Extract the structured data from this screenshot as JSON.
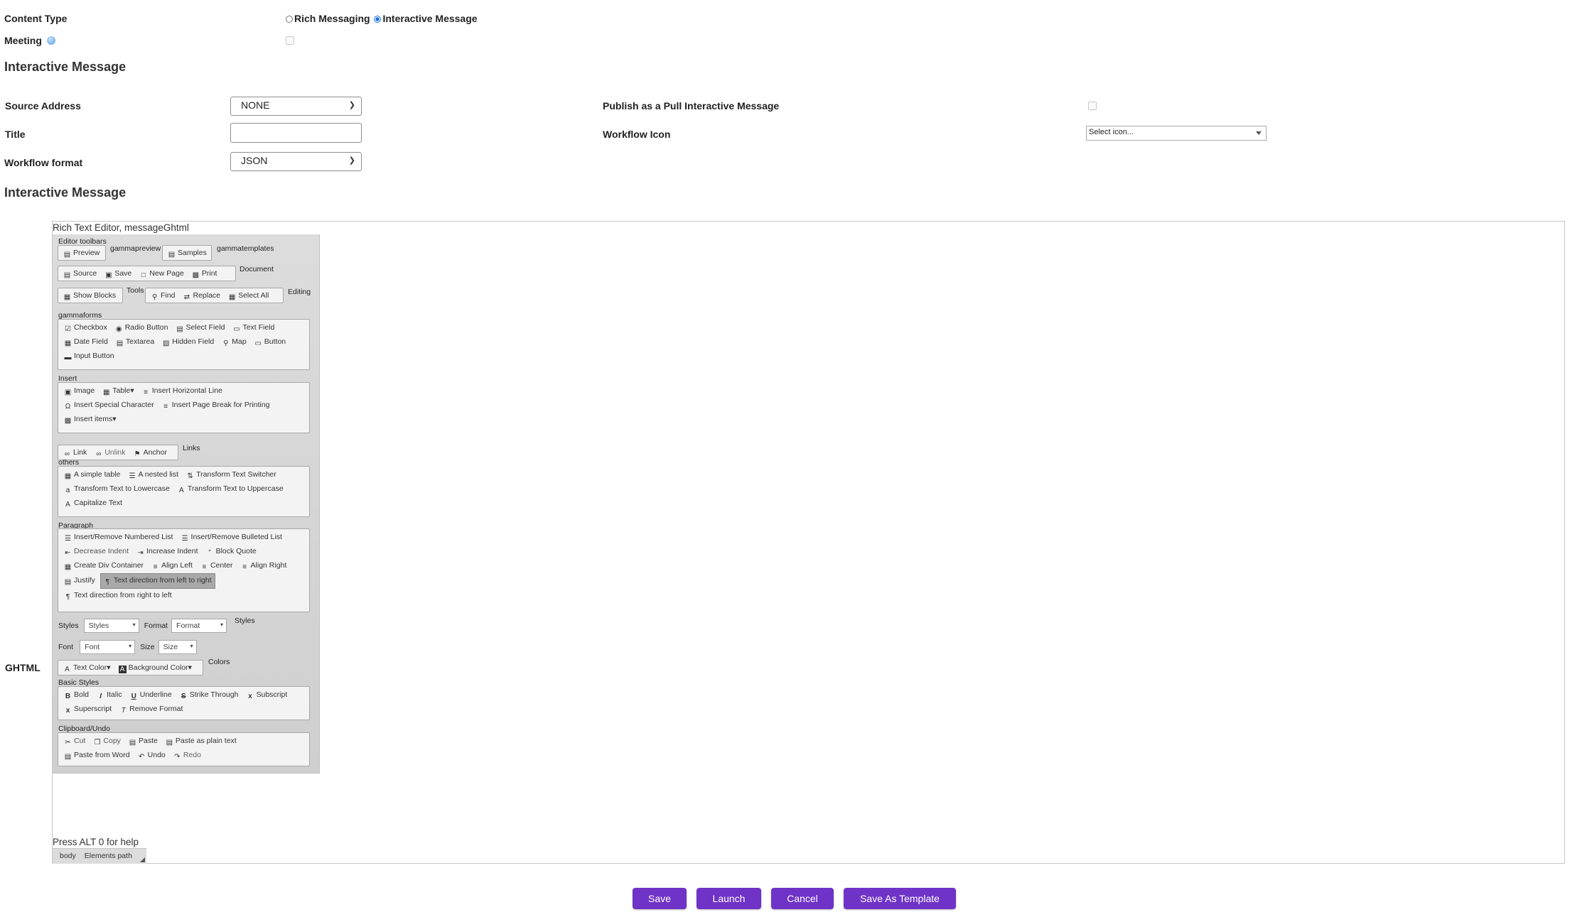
{
  "form": {
    "content_type_label": "Content Type",
    "content_type_options": [
      "Rich Messaging",
      "Interactive Message"
    ],
    "meeting_label": "Meeting",
    "section_title": "Interactive Message",
    "source_address_label": "Source Address",
    "source_address_value": "NONE",
    "title_label": "Title",
    "title_value": "",
    "workflow_format_label": "Workflow format",
    "workflow_format_value": "JSON",
    "publish_label": "Publish as a Pull Interactive Message",
    "workflow_icon_label": "Workflow Icon",
    "workflow_icon_value": "Select icon...",
    "section_title_2": "Interactive Message",
    "ghtml_label": "GHTML"
  },
  "editor": {
    "aria_label": "Rich Text Editor, messageGhtml",
    "toolbars_label": "Editor toolbars",
    "preview_group": {
      "title": "gammapreview",
      "buttons": [
        "Preview"
      ]
    },
    "templates_group": {
      "title": "gammatemplates",
      "buttons": [
        "Samples"
      ]
    },
    "document_group": {
      "title": "Document",
      "buttons": [
        "Source",
        "Save",
        "New Page",
        "Print"
      ]
    },
    "tools_group": {
      "title": "Tools",
      "buttons": [
        "Show Blocks"
      ]
    },
    "editing_group": {
      "title": "Editing",
      "buttons": [
        "Find",
        "Replace",
        "Select All"
      ]
    },
    "forms_group": {
      "title": "gammaforms",
      "rows": [
        [
          "Checkbox",
          "Radio Button",
          "Select Field",
          "Text Field"
        ],
        [
          "Date Field",
          "Textarea",
          "Hidden Field",
          "Map",
          "Button"
        ],
        [
          "Input Button"
        ]
      ]
    },
    "insert_group": {
      "title": "Insert",
      "rows": [
        [
          "Image",
          "Table",
          "Insert Horizontal Line"
        ],
        [
          "Insert Special Character",
          "Insert Page Break for Printing"
        ],
        [
          "Insert items"
        ]
      ]
    },
    "links_group": {
      "title": "Links",
      "buttons": [
        "Link",
        "Unlink",
        "Anchor"
      ]
    },
    "others_group": {
      "title": "others",
      "rows": [
        [
          "A simple table",
          "A nested list",
          "Transform Text Switcher"
        ],
        [
          "Transform Text to Lowercase",
          "Transform Text to Uppercase"
        ],
        [
          "Capitalize Text"
        ]
      ]
    },
    "paragraph_group": {
      "title": "Paragraph",
      "rows": [
        [
          "Insert/Remove Numbered List",
          "Insert/Remove Bulleted List"
        ],
        [
          "Decrease Indent",
          "Increase Indent",
          "Block Quote"
        ],
        [
          "Create Div Container",
          "Align Left",
          "Center",
          "Align Right"
        ],
        [
          "Justify",
          "Text direction from left to right"
        ],
        [
          "Text direction from right to left"
        ]
      ]
    },
    "styles_group": {
      "title": "Styles",
      "styles_label": "Styles",
      "styles_value": "Styles",
      "format_label": "Format",
      "format_value": "Format",
      "font_label": "Font",
      "font_value": "Font",
      "size_label": "Size",
      "size_value": "Size"
    },
    "colors_group": {
      "title": "Colors",
      "buttons": [
        "Text Color",
        "Background Color"
      ]
    },
    "basic_group": {
      "title": "Basic Styles",
      "rows": [
        [
          "Bold",
          "Italic",
          "Underline",
          "Strike Through",
          "Subscript"
        ],
        [
          "Superscript",
          "Remove Format"
        ]
      ]
    },
    "clipboard_group": {
      "title": "Clipboard/Undo",
      "rows": [
        [
          "Cut",
          "Copy",
          "Paste",
          "Paste as plain text"
        ],
        [
          "Paste from Word",
          "Undo",
          "Redo"
        ]
      ]
    },
    "help_text": "Press ALT 0 for help",
    "path_body": "body",
    "path_label": "Elements path"
  },
  "actions": {
    "save": "Save",
    "launch": "Launch",
    "cancel": "Cancel",
    "save_template": "Save As Template"
  },
  "colors": {
    "accent": "#6f33c7",
    "toolbar_bg": "#d8d8d8"
  }
}
